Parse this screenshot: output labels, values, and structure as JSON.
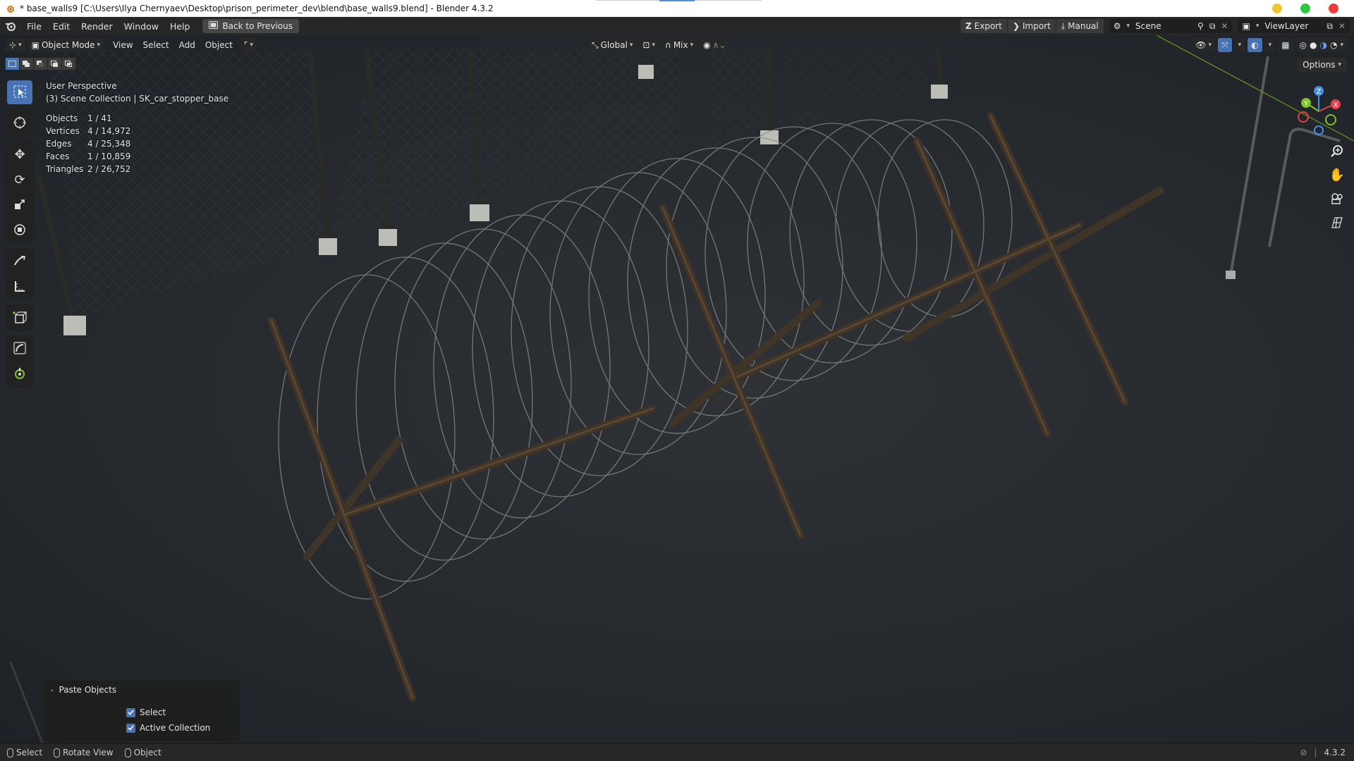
{
  "window": {
    "title": "* base_walls9 [C:\\Users\\Ilya Chernyaev\\Desktop\\prison_perimeter_dev\\blend\\base_walls9.blend] - Blender 4.3.2",
    "controls": {
      "minimize_color": "#f4c430",
      "maximize_color": "#2ec840",
      "close_color": "#ee3b3b"
    }
  },
  "menubar": {
    "items": [
      "File",
      "Edit",
      "Render",
      "Window",
      "Help"
    ],
    "back_button": "Back to Previous",
    "export": "Export",
    "import": "Import",
    "manual": "Manual",
    "scene": "Scene",
    "view_layer": "ViewLayer"
  },
  "viewport_header": {
    "mode": "Object Mode",
    "menus": [
      "View",
      "Select",
      "Add",
      "Object"
    ],
    "orientation": "Global",
    "snap_mode": "Mix",
    "options": "Options"
  },
  "overlay": {
    "perspective": "User Perspective",
    "collection": "(3) Scene Collection | SK_car_stopper_base",
    "stats": [
      {
        "label": "Objects",
        "value": "1 / 41"
      },
      {
        "label": "Vertices",
        "value": "4 / 14,972"
      },
      {
        "label": "Edges",
        "value": "4 / 25,348"
      },
      {
        "label": "Faces",
        "value": "1 / 10,859"
      },
      {
        "label": "Triangles",
        "value": "2 / 26,752"
      }
    ]
  },
  "gizmo": {
    "x": "X",
    "y": "Y",
    "z": "Z",
    "x_color": "#e8404a",
    "y_color": "#7fc32c",
    "z_color": "#3d8fe6"
  },
  "paste_panel": {
    "title": "Paste Objects",
    "options": [
      {
        "label": "Select",
        "checked": true
      },
      {
        "label": "Active Collection",
        "checked": true
      }
    ]
  },
  "statusbar": {
    "select": "Select",
    "rotate": "Rotate View",
    "object": "Object",
    "version": "4.3.2"
  },
  "accent_color": "#4772b3"
}
